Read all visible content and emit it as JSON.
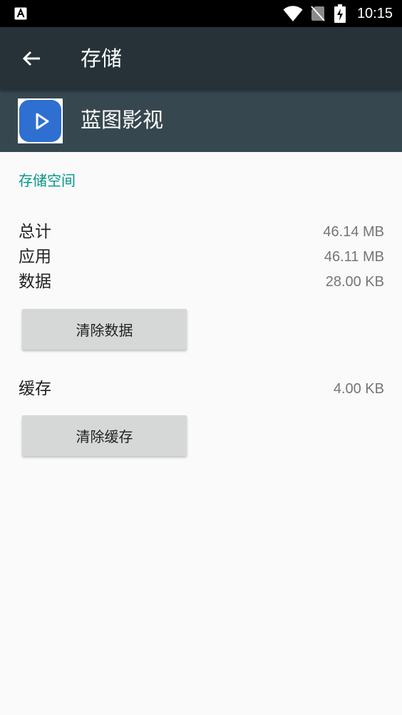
{
  "status_bar": {
    "time": "10:15",
    "icons": [
      "notification-a-icon",
      "wifi-icon",
      "no-sim-icon",
      "battery-charging-icon"
    ],
    "background": "#000000"
  },
  "toolbar": {
    "title": "存储",
    "back_icon": "arrow-back-icon",
    "background": "#263238"
  },
  "app_header": {
    "name": "蓝图影视",
    "icon": "play-icon",
    "background": "#37474f",
    "icon_color": "#2f6fd1"
  },
  "storage": {
    "section_title": "存储空间",
    "accent": "#009688",
    "rows": [
      {
        "label": "总计",
        "value": "46.14 MB"
      },
      {
        "label": "应用",
        "value": "46.11 MB"
      },
      {
        "label": "数据",
        "value": "28.00 KB"
      }
    ],
    "clear_data_label": "清除数据"
  },
  "cache": {
    "label": "缓存",
    "value": "4.00 KB",
    "clear_cache_label": "清除缓存"
  }
}
